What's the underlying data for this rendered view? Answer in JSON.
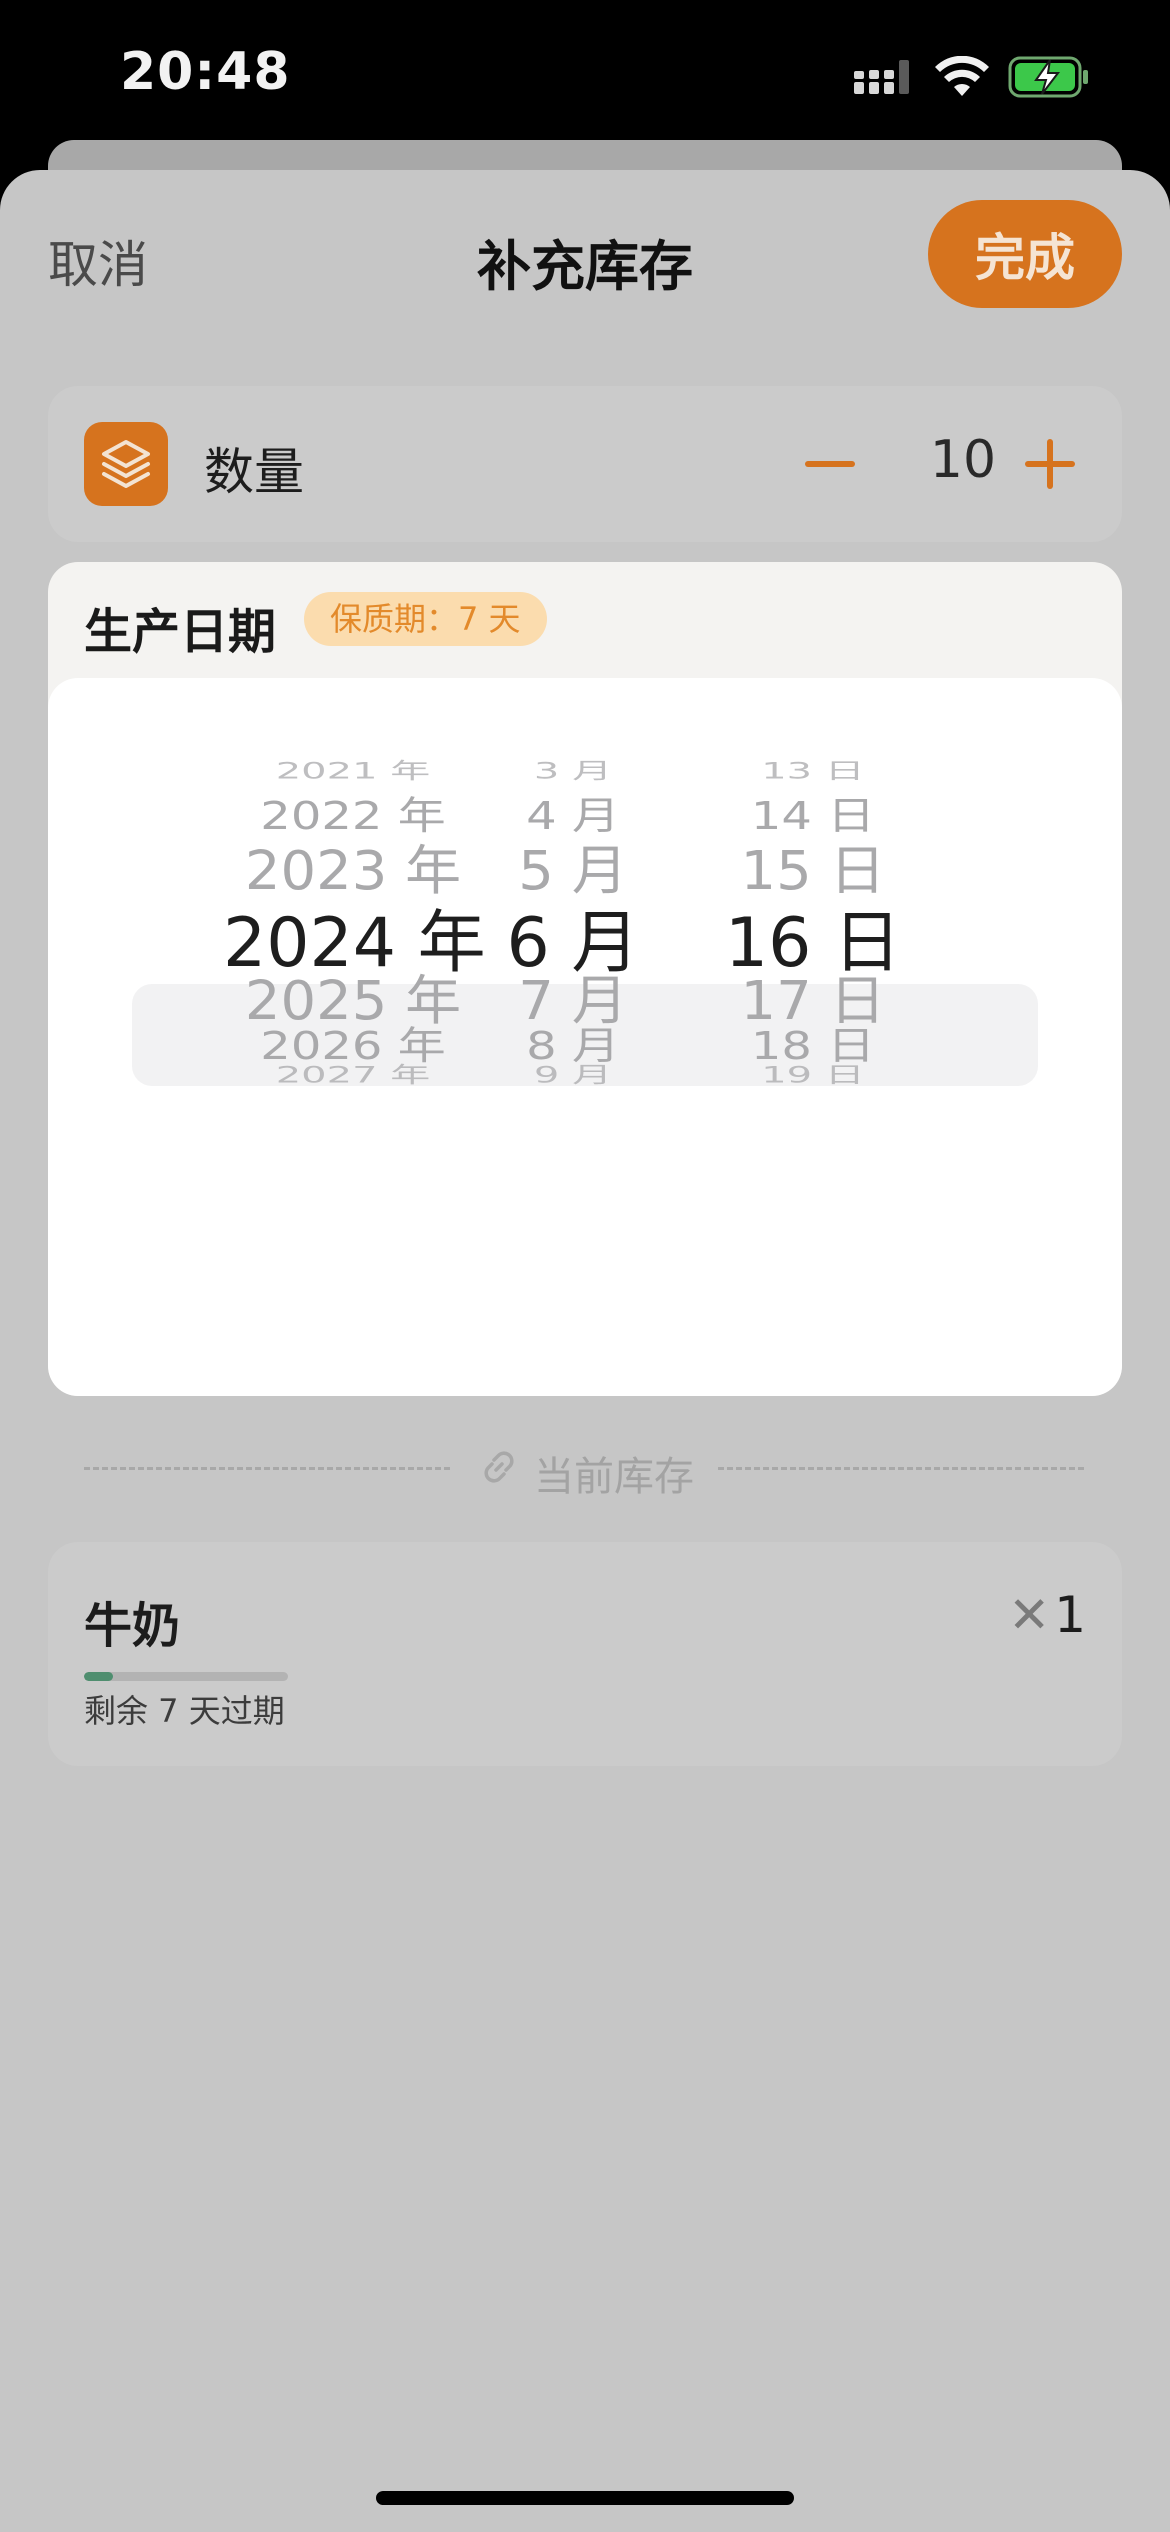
{
  "status_bar": {
    "time": "20:48"
  },
  "nav": {
    "cancel_label": "取消",
    "title": "补充库存",
    "done_label": "完成"
  },
  "quantity": {
    "label": "数量",
    "value": "10",
    "icon": "stack-layers-icon"
  },
  "production_date": {
    "label": "生产日期",
    "shelf_life_badge": "保质期：7 天",
    "picker": {
      "year": [
        "2021 年",
        "2022 年",
        "2023 年",
        "2024 年",
        "2025 年",
        "2026 年",
        "2027 年"
      ],
      "month": [
        "3 月",
        "4 月",
        "5 月",
        "6 月",
        "7 月",
        "8 月",
        "9 月"
      ],
      "day": [
        "13 日",
        "14 日",
        "15 日",
        "16 日",
        "17 日",
        "18 日",
        "19 日"
      ],
      "selected_index": 3
    }
  },
  "current_stock": {
    "divider_label": "当前库存",
    "items": [
      {
        "name": "牛奶",
        "count": "1",
        "times_symbol": "✕",
        "expire_text": "剩余 7 天过期",
        "freshness_fraction": 0.14
      }
    ]
  },
  "colors": {
    "accent": "#d6731e",
    "badge_bg": "#fbdcae",
    "badge_text": "#e38a2b",
    "progress": "#4f8e6f"
  }
}
